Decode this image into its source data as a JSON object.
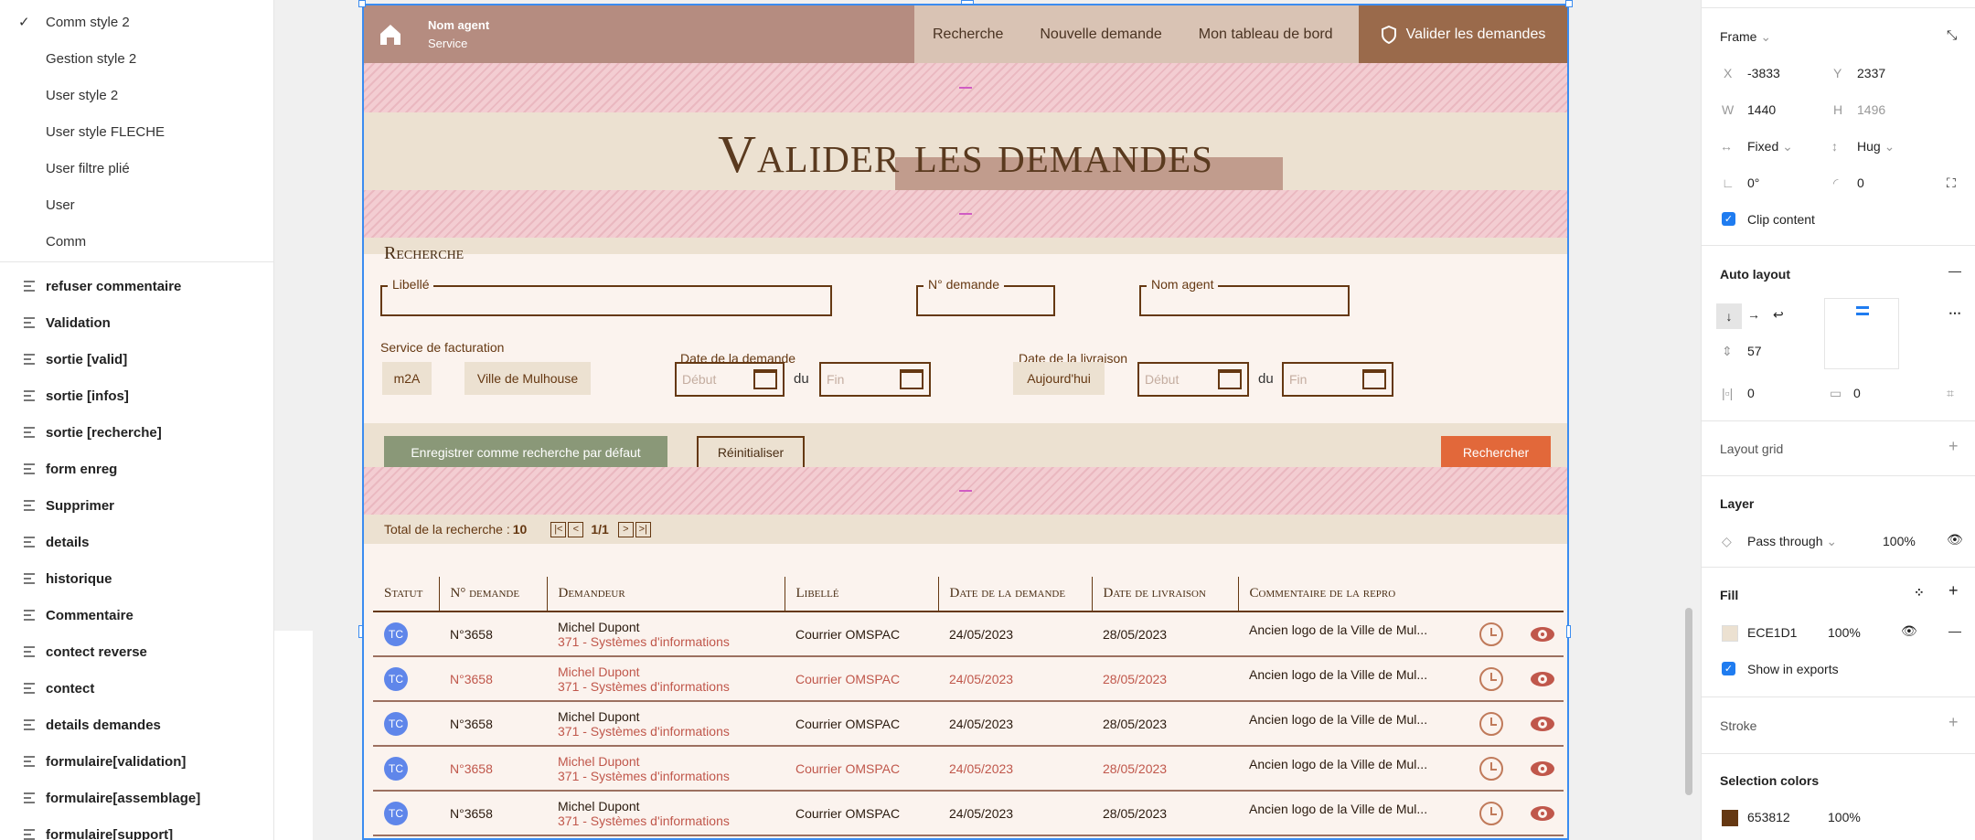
{
  "layers_top": [
    {
      "label": "Comm style 2",
      "checked": true
    },
    {
      "label": "Gestion style 2"
    },
    {
      "label": "User style 2"
    },
    {
      "label": "User style FLECHE"
    },
    {
      "label": "User filtre plié"
    },
    {
      "label": "User"
    },
    {
      "label": "Comm"
    }
  ],
  "layers": [
    "refuser commentaire",
    "Validation",
    "sortie [valid]",
    "sortie [infos]",
    "sortie [recherche]",
    "form enreg",
    "Supprimer",
    "details",
    "historique",
    "Commentaire",
    "contect reverse",
    "contect",
    "details demandes",
    "formulaire[validation]",
    "formulaire[assemblage]",
    "formulaire[support]"
  ],
  "header": {
    "agent_name": "Nom agent",
    "agent_service": "Service",
    "nav": [
      "Recherche",
      "Nouvelle demande",
      "Mon tableau de bord"
    ],
    "validate_label": "Valider les demandes"
  },
  "page_title": "Valider les demandes",
  "search": {
    "title": "Recherche",
    "libelle": "Libellé",
    "numero": "N° demande",
    "nom_agent": "Nom agent",
    "service_label": "Service de facturation",
    "service_options": [
      "m2A",
      "Ville de Mulhouse"
    ],
    "date_demande_label": "Date de la demande",
    "date_livraison_label": "Date de la livraison",
    "start_placeholder": "Début",
    "end_placeholder": "Fin",
    "du": "du",
    "aujourdhui": "Aujourd'hui"
  },
  "actions": {
    "save_default": "Enregistrer comme recherche par défaut",
    "reset": "Réinitialiser",
    "search": "Rechercher"
  },
  "pagination": {
    "total_label": "Total de la recherche : ",
    "total": "10",
    "page": "1/1"
  },
  "table": {
    "headers": [
      "Statut",
      "N° demande",
      "Demandeur",
      "Libellé",
      "Date de la demande",
      "Date de livraison",
      "Commentaire de la repro"
    ],
    "rows": [
      {
        "status": "TC",
        "num": "N°3658",
        "name": "Michel Dupont",
        "dept": "371 - Systèmes d'informations",
        "libelle": "Courrier OMSPAC",
        "date_dem": "24/05/2023",
        "date_liv": "28/05/2023",
        "comment": "Ancien logo de la Ville de Mul..."
      },
      {
        "status": "TC",
        "num": "N°3658",
        "name": "Michel Dupont",
        "dept": "371 - Systèmes d'informations",
        "libelle": "Courrier OMSPAC",
        "date_dem": "24/05/2023",
        "date_liv": "28/05/2023",
        "comment": "Ancien logo de la Ville de Mul..."
      },
      {
        "status": "TC",
        "num": "N°3658",
        "name": "Michel Dupont",
        "dept": "371 - Systèmes d'informations",
        "libelle": "Courrier OMSPAC",
        "date_dem": "24/05/2023",
        "date_liv": "28/05/2023",
        "comment": "Ancien logo de la Ville de Mul..."
      },
      {
        "status": "TC",
        "num": "N°3658",
        "name": "Michel Dupont",
        "dept": "371 - Systèmes d'informations",
        "libelle": "Courrier OMSPAC",
        "date_dem": "24/05/2023",
        "date_liv": "28/05/2023",
        "comment": "Ancien logo de la Ville de Mul..."
      },
      {
        "status": "TC",
        "num": "N°3658",
        "name": "Michel Dupont",
        "dept": "371 - Systèmes d'informations",
        "libelle": "Courrier OMSPAC",
        "date_dem": "24/05/2023",
        "date_liv": "28/05/2023",
        "comment": "Ancien logo de la Ville de Mul..."
      }
    ]
  },
  "panel": {
    "frame_label": "Frame",
    "x_label": "X",
    "x": "-3833",
    "y_label": "Y",
    "y": "2337",
    "w_label": "W",
    "w": "1440",
    "h_label": "H",
    "h": "1496",
    "h_sizing": "Fixed",
    "v_sizing": "Hug",
    "rotation": "0°",
    "radius": "0",
    "clip": "Clip content",
    "auto_layout": "Auto layout",
    "gap": "57",
    "pad_h": "0",
    "pad_v": "0",
    "layout_grid": "Layout grid",
    "layer": "Layer",
    "blend": "Pass through",
    "opacity": "100%",
    "fill": "Fill",
    "fill_hex": "ECE1D1",
    "fill_opacity": "100%",
    "show_exports": "Show in exports",
    "stroke": "Stroke",
    "selection_colors": "Selection colors",
    "sel_hex": "653812",
    "sel_opacity": "100%"
  },
  "colors": {
    "fill": "#ECE1D1",
    "selection": "#653812",
    "accent": "#E2683A",
    "green": "#8A9878",
    "blue": "#1f7cf0"
  }
}
